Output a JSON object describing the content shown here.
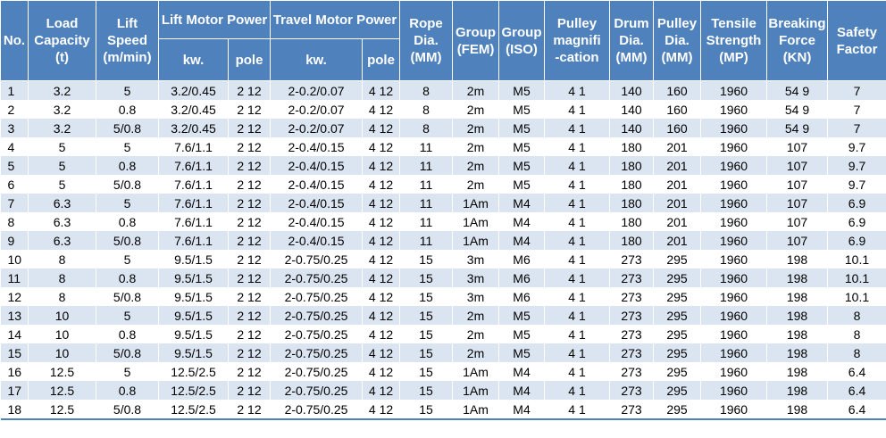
{
  "headers": {
    "no": "No.",
    "load_capacity": [
      "Load",
      "Capacity",
      "(t)"
    ],
    "lift_speed": [
      "Lift",
      "Speed",
      "(m/min)"
    ],
    "lift_motor_power": "Lift Motor Power",
    "travel_motor_power": "Travel Motor Power",
    "lift_kw": "kw.",
    "lift_pole": "pole",
    "travel_kw": "kw.",
    "travel_pole": "pole",
    "rope_dia": [
      "Rope",
      "Dia.",
      "(MM)"
    ],
    "group_fem": [
      "Group",
      "(FEM)"
    ],
    "group_iso": [
      "Group",
      "(ISO)"
    ],
    "pulley_magnification": [
      "Pulley",
      "magnifi",
      "-cation"
    ],
    "drum_dia": [
      "Drum",
      "Dia.",
      "(MM)"
    ],
    "pulley_dia": [
      "Pulley",
      "Dia.",
      "(MM)"
    ],
    "tensile_strength": [
      "Tensile",
      "Strength",
      "(MP)"
    ],
    "breaking_force": [
      "Breaking",
      "Force",
      "(KN)"
    ],
    "safety_factor": [
      "Safety",
      "Factor"
    ]
  },
  "rows": [
    [
      "1",
      "3.2",
      "5",
      "3.2/0.45",
      "2 12",
      "2-0.2/0.07",
      "4 12",
      "8",
      "2m",
      "M5",
      "4 1",
      "140",
      "160",
      "1960",
      "54 9",
      "7"
    ],
    [
      "2",
      "3.2",
      "0.8",
      "3.2/0.45",
      "2 12",
      "2-0.2/0.07",
      "4 12",
      "8",
      "2m",
      "M5",
      "4 1",
      "140",
      "160",
      "1960",
      "54 9",
      "7"
    ],
    [
      "3",
      "3.2",
      "5/0.8",
      "3.2/0.45",
      "2 12",
      "2-0.2/0.07",
      "4 12",
      "8",
      "2m",
      "M5",
      "4 1",
      "140",
      "160",
      "1960",
      "54 9",
      "7"
    ],
    [
      "4",
      "5",
      "5",
      "7.6/1.1",
      "2 12",
      "2-0.4/0.15",
      "4 12",
      "11",
      "2m",
      "M5",
      "4 1",
      "180",
      "201",
      "1960",
      "107",
      "9.7"
    ],
    [
      "5",
      "5",
      "0.8",
      "7.6/1.1",
      "2 12",
      "2-0.4/0.15",
      "4 12",
      "11",
      "2m",
      "M5",
      "4 1",
      "180",
      "201",
      "1960",
      "107",
      "9.7"
    ],
    [
      "6",
      "5",
      "5/0.8",
      "7.6/1.1",
      "2 12",
      "2-0.4/0.15",
      "4 12",
      "11",
      "2m",
      "M5",
      "4 1",
      "180",
      "201",
      "1960",
      "107",
      "9.7"
    ],
    [
      "7",
      "6.3",
      "5",
      "7.6/1.1",
      "2 12",
      "2-0.4/0.15",
      "4 12",
      "11",
      "1Am",
      "M4",
      "4 1",
      "180",
      "201",
      "1960",
      "107",
      "6.9"
    ],
    [
      "8",
      "6.3",
      "0.8",
      "7.6/1.1",
      "2 12",
      "2-0.4/0.15",
      "4 12",
      "11",
      "1Am",
      "M4",
      "4 1",
      "180",
      "201",
      "1960",
      "107",
      "6.9"
    ],
    [
      "9",
      "6.3",
      "5/0.8",
      "7.6/1.1",
      "2 12",
      "2-0.4/0.15",
      "4 12",
      "11",
      "1Am",
      "M4",
      "4 1",
      "180",
      "201",
      "1960",
      "107",
      "6.9"
    ],
    [
      "10",
      "8",
      "5",
      "9.5/1.5",
      "2 12",
      "2-0.75/0.25",
      "4 12",
      "15",
      "3m",
      "M6",
      "4 1",
      "273",
      "295",
      "1960",
      "198",
      "10.1"
    ],
    [
      "11",
      "8",
      "0.8",
      "9.5/1.5",
      "2 12",
      "2-0.75/0.25",
      "4 12",
      "15",
      "3m",
      "M6",
      "4 1",
      "273",
      "295",
      "1960",
      "198",
      "10.1"
    ],
    [
      "12",
      "8",
      "5/0.8",
      "9.5/1.5",
      "2 12",
      "2-0.75/0.25",
      "4 12",
      "15",
      "3m",
      "M6",
      "4 1",
      "273",
      "295",
      "1960",
      "198",
      "10.1"
    ],
    [
      "13",
      "10",
      "5",
      "9.5/1.5",
      "2 12",
      "2-0.75/0.25",
      "4 12",
      "15",
      "2m",
      "M5",
      "4 1",
      "273",
      "295",
      "1960",
      "198",
      "8"
    ],
    [
      "14",
      "10",
      "0.8",
      "9.5/1.5",
      "2 12",
      "2-0.75/0.25",
      "4 12",
      "15",
      "2m",
      "M5",
      "4 1",
      "273",
      "295",
      "1960",
      "198",
      "8"
    ],
    [
      "15",
      "10",
      "5/0.8",
      "9.5/1.5",
      "2 12",
      "2-0.75/0.25",
      "4 12",
      "15",
      "2m",
      "M5",
      "4 1",
      "273",
      "295",
      "1960",
      "198",
      "8"
    ],
    [
      "16",
      "12.5",
      "5",
      "12.5/2.5",
      "2 12",
      "2-0.75/0.25",
      "4 12",
      "15",
      "1Am",
      "M4",
      "4 1",
      "273",
      "295",
      "1960",
      "198",
      "6.4"
    ],
    [
      "17",
      "12.5",
      "0.8",
      "12.5/2.5",
      "2 12",
      "2-0.75/0.25",
      "4 12",
      "15",
      "1Am",
      "M4",
      "4 1",
      "273",
      "295",
      "1960",
      "198",
      "6.4"
    ],
    [
      "18",
      "12.5",
      "5/0.8",
      "12.5/2.5",
      "2 12",
      "2-0.75/0.25",
      "4 12",
      "15",
      "1Am",
      "M4",
      "4 1",
      "273",
      "295",
      "1960",
      "198",
      "6.4"
    ]
  ],
  "colors": {
    "header_bg": "#4f81bd",
    "header_text": "#ffffff",
    "row_band": "#dbe5f1",
    "row_plain": "#ffffff"
  }
}
